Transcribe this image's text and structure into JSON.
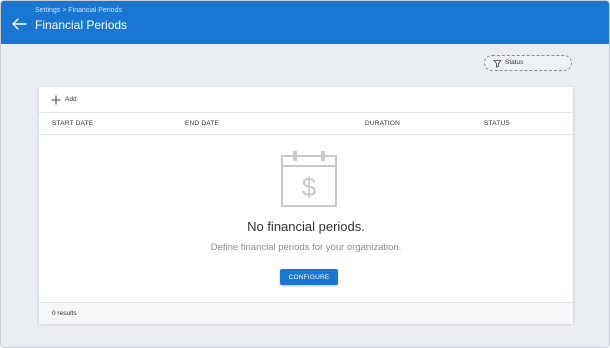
{
  "header": {
    "breadcrumb": "Settings > Financial Periods",
    "title": "Financial Periods",
    "background_color": "#1976d2"
  },
  "filters": {
    "status_label": "Status"
  },
  "toolbar": {
    "add_label": "Add"
  },
  "table": {
    "columns": [
      "START DATE",
      "END DATE",
      "DURATION",
      "STATUS"
    ],
    "rows": []
  },
  "empty_state": {
    "icon": "calendar-dollar-icon",
    "title": "No financial periods.",
    "subtitle": "Define financial periods for your organization.",
    "button_label": "CONFIGURE"
  },
  "footer": {
    "results": "0 results"
  }
}
